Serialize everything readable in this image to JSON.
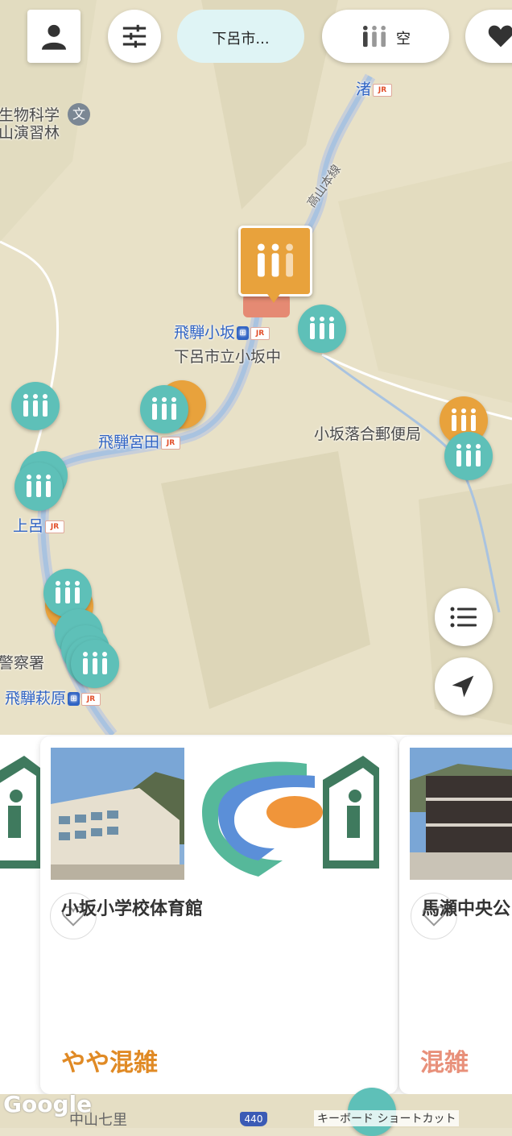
{
  "top_bar": {
    "location_label": "下呂市...",
    "crowd_label": "空"
  },
  "map": {
    "labels": {
      "nagisa": "渚",
      "bio_lab": "生物科学",
      "forest": "山演習林",
      "takayama_line": "高山本線",
      "hida_osaka": "飛騨小坂",
      "osaka_jhs": "下呂市立小坂中",
      "hida_miyada": "飛騨宮田",
      "post_office": "小坂落合郵便局",
      "joro": "上呂",
      "police": "警察署",
      "hida_hagiwara": "飛騨萩原",
      "nakayama": "中山七里",
      "route": "440"
    },
    "google": "Google",
    "shortcuts": "キーボード ショートカット",
    "colors": {
      "teal": "#5ec0b8",
      "orange": "#e8a23c",
      "salmon": "#e58a73"
    }
  },
  "cards": [
    {
      "title": "小坂小学校体育館",
      "status": "やや混雑",
      "status_color": "#e08a25"
    },
    {
      "title": "馬瀬中央公",
      "status": "混雑",
      "status_color": "#e8907a"
    }
  ],
  "icons": {
    "profile": "person-icon",
    "filter": "sliders-icon",
    "crowd": "people-icon",
    "favorite": "heart-icon",
    "list": "list-icon",
    "locate": "navigation-arrow-icon"
  }
}
